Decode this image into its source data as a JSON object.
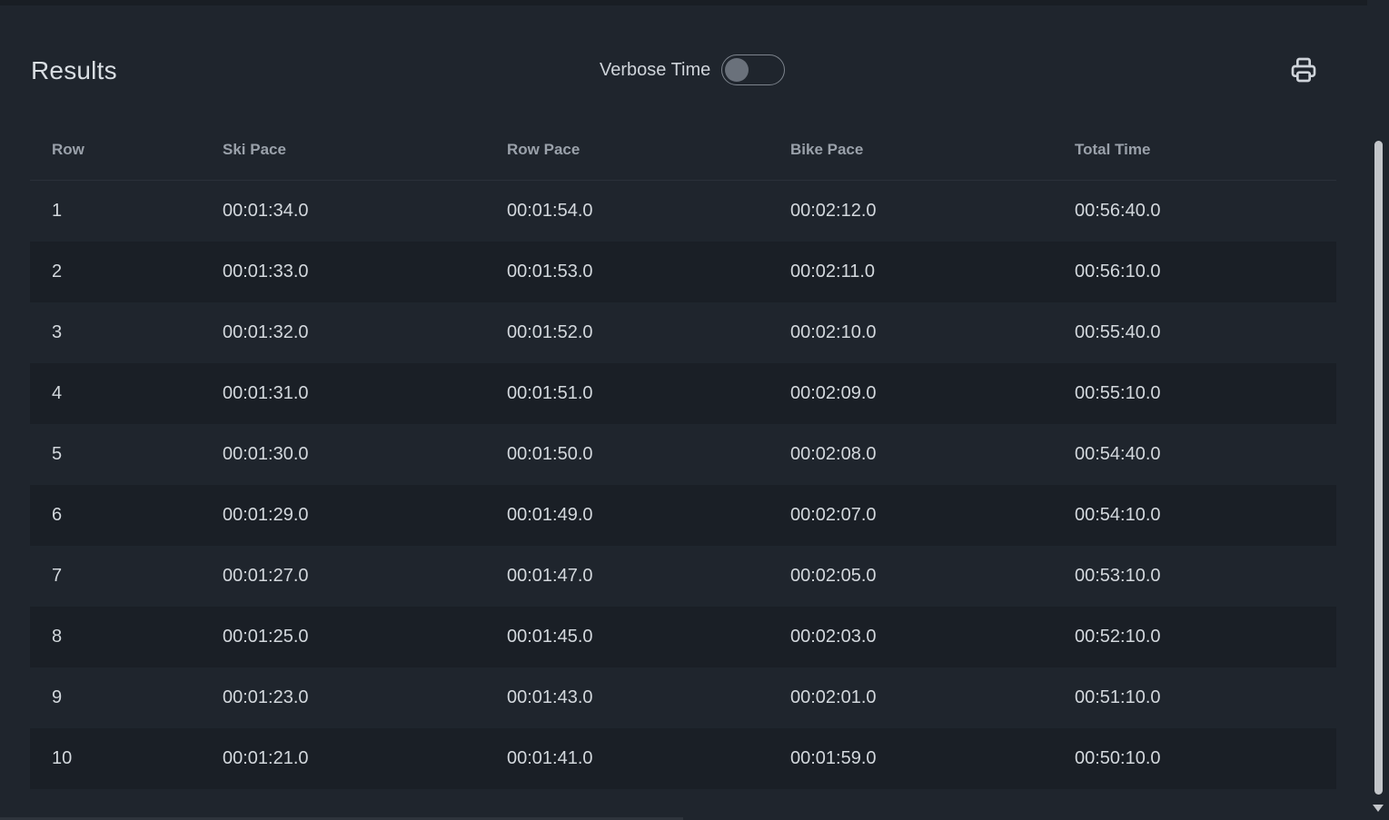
{
  "header": {
    "title": "Results",
    "verbose_toggle": {
      "label": "Verbose Time",
      "checked": false
    },
    "print_icon": "printer-icon"
  },
  "table": {
    "columns": [
      "Row",
      "Ski Pace",
      "Row Pace",
      "Bike Pace",
      "Total Time"
    ],
    "rows": [
      [
        "1",
        "00:01:34.0",
        "00:01:54.0",
        "00:02:12.0",
        "00:56:40.0"
      ],
      [
        "2",
        "00:01:33.0",
        "00:01:53.0",
        "00:02:11.0",
        "00:56:10.0"
      ],
      [
        "3",
        "00:01:32.0",
        "00:01:52.0",
        "00:02:10.0",
        "00:55:40.0"
      ],
      [
        "4",
        "00:01:31.0",
        "00:01:51.0",
        "00:02:09.0",
        "00:55:10.0"
      ],
      [
        "5",
        "00:01:30.0",
        "00:01:50.0",
        "00:02:08.0",
        "00:54:40.0"
      ],
      [
        "6",
        "00:01:29.0",
        "00:01:49.0",
        "00:02:07.0",
        "00:54:10.0"
      ],
      [
        "7",
        "00:01:27.0",
        "00:01:47.0",
        "00:02:05.0",
        "00:53:10.0"
      ],
      [
        "8",
        "00:01:25.0",
        "00:01:45.0",
        "00:02:03.0",
        "00:52:10.0"
      ],
      [
        "9",
        "00:01:23.0",
        "00:01:43.0",
        "00:02:01.0",
        "00:51:10.0"
      ],
      [
        "10",
        "00:01:21.0",
        "00:01:41.0",
        "00:01:59.0",
        "00:50:10.0"
      ]
    ]
  },
  "colors": {
    "background": "#1f252d",
    "row_alt": "#1a1f26",
    "header_text": "#9aa1aa",
    "body_text": "#d3d8dd"
  }
}
